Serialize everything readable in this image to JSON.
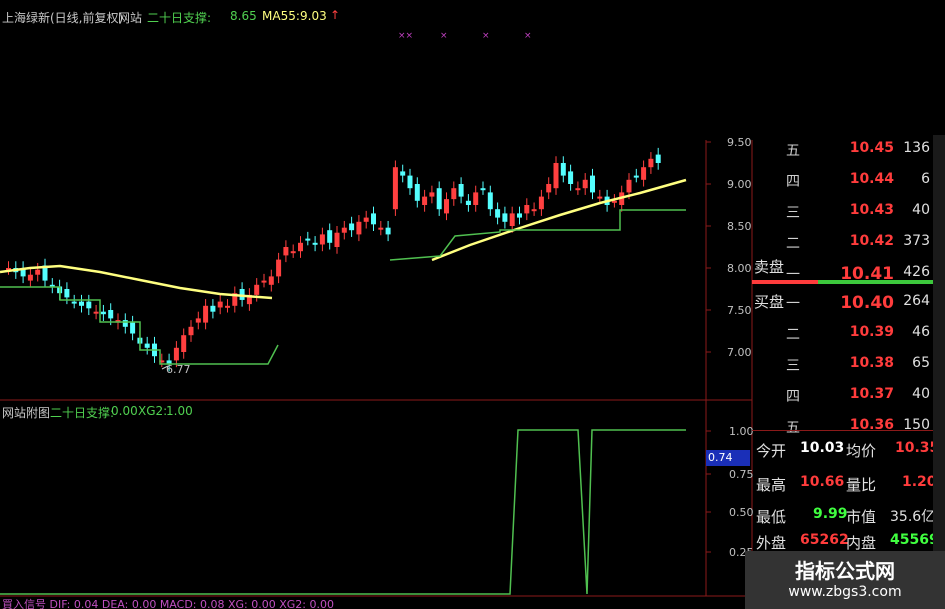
{
  "header": {
    "stock": "上海绿新(日线,前复权)",
    "site": "网站",
    "ind1_label": "二十日支撑:",
    "ind1_val": "8.65",
    "ma_label": "MA55:",
    "ma_val": "9.03",
    "arrow": "↑",
    "marks": [
      "××",
      "×",
      "×",
      "×"
    ]
  },
  "main_chart": {
    "y_ticks": [
      "9.50",
      "9.00",
      "8.50",
      "8.00",
      "7.50",
      "7.00"
    ],
    "low_label": "6.77",
    "colors": {
      "up": "#ff4040",
      "down": "#54ffff",
      "ma": "#ffff80",
      "support": "#50c050",
      "axis": "#8b1a1a"
    }
  },
  "sub_chart": {
    "title": "网站附图",
    "ind_label": "二十日支撑:",
    "ind_val": "0.00",
    "xg_label": "XG2:",
    "xg_val": "1.00",
    "y_ticks": [
      "1.00",
      "0.75",
      "0.50",
      "0.25"
    ],
    "cursor_value": "0.74"
  },
  "bottom_bar": {
    "text": "買入信号  DIF: 0.04  DEA: 0.00  MACD: 0.08  XG: 0.00  XG2: 0.00"
  },
  "order_book": {
    "sell_header": "卖盘",
    "buy_header": "买盘",
    "sell": [
      {
        "label": "五",
        "price": "10.45",
        "vol": "136"
      },
      {
        "label": "四",
        "price": "10.44",
        "vol": "6"
      },
      {
        "label": "三",
        "price": "10.43",
        "vol": "40"
      },
      {
        "label": "二",
        "price": "10.42",
        "vol": "373"
      },
      {
        "label": "一",
        "price": "10.41",
        "vol": "426"
      }
    ],
    "buy": [
      {
        "label": "一",
        "price": "10.40",
        "vol": "264"
      },
      {
        "label": "二",
        "price": "10.39",
        "vol": "46"
      },
      {
        "label": "三",
        "price": "10.38",
        "vol": "65"
      },
      {
        "label": "四",
        "price": "10.37",
        "vol": "40"
      },
      {
        "label": "五",
        "price": "10.36",
        "vol": "150"
      }
    ]
  },
  "quote": {
    "open_label": "今开",
    "open": "10.03",
    "avg_label": "均价",
    "avg": "10.35",
    "high_label": "最高",
    "high": "10.66",
    "vr_label": "量比",
    "vr": "1.20",
    "low_label": "最低",
    "low": "9.99",
    "mcap_label": "市值",
    "mcap": "35.6亿",
    "outer_label": "外盘",
    "outer": "65262",
    "inner_label": "内盘",
    "inner": "45569"
  },
  "watermark": {
    "line1": "指标公式网",
    "line2": "www.zbgs3.com"
  }
}
